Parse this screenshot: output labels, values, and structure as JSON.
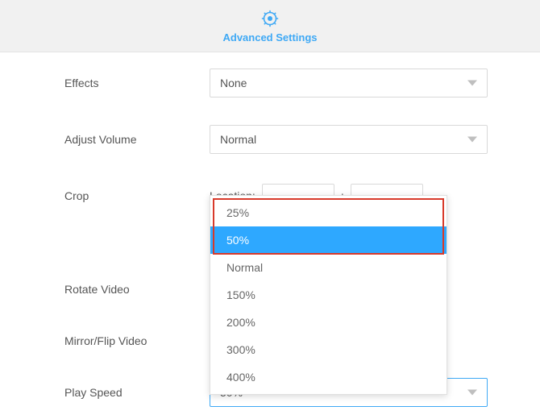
{
  "header": {
    "title": "Advanced Settings",
    "icon": "gear-icon"
  },
  "form": {
    "effects": {
      "label": "Effects",
      "value": "None"
    },
    "adjust_volume": {
      "label": "Adjust Volume",
      "value": "Normal"
    },
    "crop": {
      "label": "Crop",
      "location_label": "Location:",
      "x": "",
      "y": "",
      "sep": ":"
    },
    "rotate_video": {
      "label": "Rotate Video"
    },
    "mirror_flip": {
      "label": "Mirror/Flip Video"
    },
    "play_speed": {
      "label": "Play Speed",
      "value": "50%",
      "options": [
        "25%",
        "50%",
        "Normal",
        "150%",
        "200%",
        "300%",
        "400%"
      ],
      "selected_index": 1
    }
  }
}
